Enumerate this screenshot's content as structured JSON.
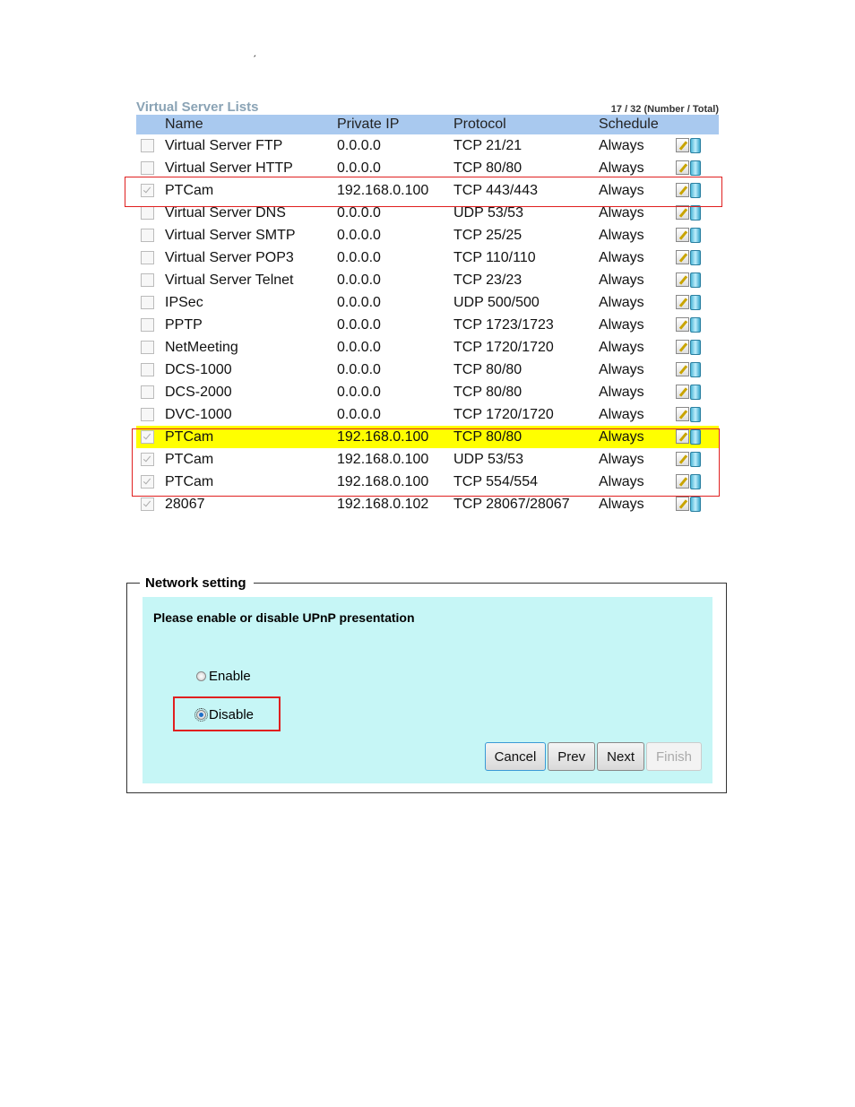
{
  "stray_mark": "ˏ",
  "virtual_server": {
    "title": "Virtual Server Lists",
    "count": "17 / 32 (Number / Total)",
    "columns": [
      "",
      "Name",
      "Private IP",
      "Protocol",
      "Schedule",
      ""
    ],
    "rows": [
      {
        "checked": false,
        "name": "Virtual Server FTP",
        "ip": "0.0.0.0",
        "protocol": "TCP 21/21",
        "schedule": "Always"
      },
      {
        "checked": false,
        "name": "Virtual Server HTTP",
        "ip": "0.0.0.0",
        "protocol": "TCP 80/80",
        "schedule": "Always"
      },
      {
        "checked": true,
        "name": "PTCam",
        "ip": "192.168.0.100",
        "protocol": "TCP 443/443",
        "schedule": "Always"
      },
      {
        "checked": false,
        "name": "Virtual Server DNS",
        "ip": "0.0.0.0",
        "protocol": "UDP 53/53",
        "schedule": "Always"
      },
      {
        "checked": false,
        "name": "Virtual Server SMTP",
        "ip": "0.0.0.0",
        "protocol": "TCP 25/25",
        "schedule": "Always"
      },
      {
        "checked": false,
        "name": "Virtual Server POP3",
        "ip": "0.0.0.0",
        "protocol": "TCP 110/110",
        "schedule": "Always"
      },
      {
        "checked": false,
        "name": "Virtual Server Telnet",
        "ip": "0.0.0.0",
        "protocol": "TCP 23/23",
        "schedule": "Always"
      },
      {
        "checked": false,
        "name": "IPSec",
        "ip": "0.0.0.0",
        "protocol": "UDP 500/500",
        "schedule": "Always"
      },
      {
        "checked": false,
        "name": "PPTP",
        "ip": "0.0.0.0",
        "protocol": "TCP 1723/1723",
        "schedule": "Always"
      },
      {
        "checked": false,
        "name": "NetMeeting",
        "ip": "0.0.0.0",
        "protocol": "TCP 1720/1720",
        "schedule": "Always"
      },
      {
        "checked": false,
        "name": "DCS-1000",
        "ip": "0.0.0.0",
        "protocol": "TCP 80/80",
        "schedule": "Always"
      },
      {
        "checked": false,
        "name": "DCS-2000",
        "ip": "0.0.0.0",
        "protocol": "TCP 80/80",
        "schedule": "Always"
      },
      {
        "checked": false,
        "name": "DVC-1000",
        "ip": "0.0.0.0",
        "protocol": "TCP 1720/1720",
        "schedule": "Always"
      },
      {
        "checked": true,
        "name": "PTCam",
        "ip": "192.168.0.100",
        "protocol": "TCP 80/80",
        "schedule": "Always",
        "highlight": true
      },
      {
        "checked": true,
        "name": "PTCam",
        "ip": "192.168.0.100",
        "protocol": "UDP 53/53",
        "schedule": "Always"
      },
      {
        "checked": true,
        "name": "PTCam",
        "ip": "192.168.0.100",
        "protocol": "TCP 554/554",
        "schedule": "Always"
      },
      {
        "checked": true,
        "name": "28067",
        "ip": "192.168.0.102",
        "protocol": "TCP 28067/28067",
        "schedule": "Always"
      }
    ],
    "row_icons": [
      "edit-icon",
      "trash-icon"
    ],
    "highlight_color": "#ffff00",
    "annotation_color": "#e02020"
  },
  "network_setting": {
    "legend": "Network setting",
    "prompt": "Please enable or disable UPnP presentation",
    "options": [
      {
        "label": "Enable",
        "selected": false
      },
      {
        "label": "Disable",
        "selected": true
      }
    ],
    "buttons": {
      "cancel": "Cancel",
      "prev": "Prev",
      "next": "Next",
      "finish": "Finish"
    },
    "panel_color": "#c6f6f6"
  }
}
